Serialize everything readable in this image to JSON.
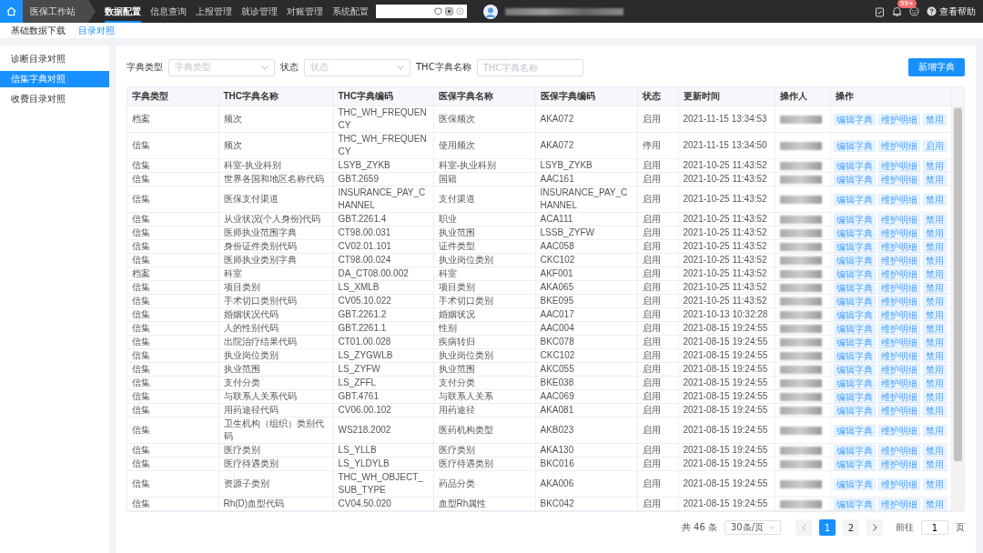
{
  "top_nav": {
    "workstation": "医保工作站",
    "menu": [
      {
        "label": "数据配置",
        "selected": true
      },
      {
        "label": "信息查询",
        "selected": false
      },
      {
        "label": "上报管理",
        "selected": false
      },
      {
        "label": "就诊管理",
        "selected": false
      },
      {
        "label": "对账管理",
        "selected": false
      },
      {
        "label": "系统配置",
        "selected": false
      }
    ],
    "badge": "99+",
    "help": "查看帮助"
  },
  "sub_nav": [
    {
      "label": "基础数据下载",
      "selected": false
    },
    {
      "label": "目录对照",
      "selected": true
    }
  ],
  "sidebar": [
    {
      "label": "诊断目录对照",
      "selected": false
    },
    {
      "label": "信集字典对照",
      "selected": true
    },
    {
      "label": "收费目录对照",
      "selected": false
    }
  ],
  "filters": [
    {
      "kind": "select",
      "label": "字典类型",
      "placeholder": "字典类型"
    },
    {
      "kind": "select",
      "label": "状态",
      "placeholder": "状态"
    },
    {
      "kind": "text",
      "label": "THC字典名称",
      "placeholder": "THC字典名称"
    }
  ],
  "add_button": "新增字典",
  "table": {
    "columns": [
      "字典类型",
      "THC字典名称",
      "THC字典编码",
      "医保字典名称",
      "医保字典编码",
      "状态",
      "更新时间",
      "操作人",
      "操作"
    ],
    "rows": [
      {
        "cells": [
          "档案",
          "频次",
          "THC_WH_FREQUENCY",
          "医保频次",
          "AKA072",
          "启用",
          "2021-11-15 13:34:53"
        ],
        "actions": [
          "编辑字典",
          "维护明细",
          "禁用"
        ]
      },
      {
        "cells": [
          "信集",
          "频次",
          "THC_WH_FREQUENCY",
          "使用频次",
          "AKA072",
          "停用",
          "2021-11-15 13:34:50"
        ],
        "actions": [
          "编辑字典",
          "维护明细",
          "启用"
        ]
      },
      {
        "cells": [
          "信集",
          "科室-执业科别",
          "LSYB_ZYKB",
          "科室-执业科别",
          "LSYB_ZYKB",
          "启用",
          "2021-10-25 11:43:52"
        ],
        "actions": [
          "编辑字典",
          "维护明细",
          "禁用"
        ]
      },
      {
        "cells": [
          "信集",
          "世界各国和地区名称代码",
          "GBT.2659",
          "国籍",
          "AAC161",
          "启用",
          "2021-10-25 11:43:52"
        ],
        "actions": [
          "编辑字典",
          "维护明细",
          "禁用"
        ]
      },
      {
        "cells": [
          "信集",
          "医保支付渠道",
          "INSURANCE_PAY_CHANNEL",
          "支付渠道",
          "INSURANCE_PAY_CHANNEL",
          "启用",
          "2021-10-25 11:43:52"
        ],
        "actions": [
          "编辑字典",
          "维护明细",
          "禁用"
        ]
      },
      {
        "cells": [
          "信集",
          "从业状况(个人身份)代码",
          "GBT.2261.4",
          "职业",
          "ACA111",
          "启用",
          "2021-10-25 11:43:52"
        ],
        "actions": [
          "编辑字典",
          "维护明细",
          "禁用"
        ]
      },
      {
        "cells": [
          "信集",
          "医师执业范围字典",
          "CT98.00.031",
          "执业范围",
          "LSSB_ZYFW",
          "启用",
          "2021-10-25 11:43:52"
        ],
        "actions": [
          "编辑字典",
          "维护明细",
          "禁用"
        ]
      },
      {
        "cells": [
          "信集",
          "身份证件类别代码",
          "CV02.01.101",
          "证件类型",
          "AAC058",
          "启用",
          "2021-10-25 11:43:52"
        ],
        "actions": [
          "编辑字典",
          "维护明细",
          "禁用"
        ]
      },
      {
        "cells": [
          "信集",
          "医师执业类别字典",
          "CT98.00.024",
          "执业岗位类别",
          "CKC102",
          "启用",
          "2021-10-25 11:43:52"
        ],
        "actions": [
          "编辑字典",
          "维护明细",
          "禁用"
        ]
      },
      {
        "cells": [
          "档案",
          "科室",
          "DA_CT08.00.002",
          "科室",
          "AKF001",
          "启用",
          "2021-10-25 11:43:52"
        ],
        "actions": [
          "编辑字典",
          "维护明细",
          "禁用"
        ]
      },
      {
        "cells": [
          "信集",
          "项目类别",
          "LS_XMLB",
          "项目类别",
          "AKA065",
          "启用",
          "2021-10-25 11:43:52"
        ],
        "actions": [
          "编辑字典",
          "维护明细",
          "禁用"
        ]
      },
      {
        "cells": [
          "信集",
          "手术切口类别代码",
          "CV05.10.022",
          "手术切口类别",
          "BKE095",
          "启用",
          "2021-10-25 11:43:52"
        ],
        "actions": [
          "编辑字典",
          "维护明细",
          "禁用"
        ]
      },
      {
        "cells": [
          "信集",
          "婚姻状况代码",
          "GBT.2261.2",
          "婚姻状况",
          "AAC017",
          "启用",
          "2021-10-13 10:32:28"
        ],
        "actions": [
          "编辑字典",
          "维护明细",
          "禁用"
        ]
      },
      {
        "cells": [
          "信集",
          "人的性别代码",
          "GBT.2261.1",
          "性别",
          "AAC004",
          "启用",
          "2021-08-15 19:24:55"
        ],
        "actions": [
          "编辑字典",
          "维护明细",
          "禁用"
        ]
      },
      {
        "cells": [
          "信集",
          "出院治疗结果代码",
          "CT01.00.028",
          "疾病转归",
          "BKC078",
          "启用",
          "2021-08-15 19:24:55"
        ],
        "actions": [
          "编辑字典",
          "维护明细",
          "禁用"
        ]
      },
      {
        "cells": [
          "信集",
          "执业岗位类别",
          "LS_ZYGWLB",
          "执业岗位类别",
          "CKC102",
          "启用",
          "2021-08-15 19:24:55"
        ],
        "actions": [
          "编辑字典",
          "维护明细",
          "禁用"
        ]
      },
      {
        "cells": [
          "信集",
          "执业范围",
          "LS_ZYFW",
          "执业范围",
          "AKC055",
          "启用",
          "2021-08-15 19:24:55"
        ],
        "actions": [
          "编辑字典",
          "维护明细",
          "禁用"
        ]
      },
      {
        "cells": [
          "信集",
          "支付分类",
          "LS_ZFFL",
          "支付分类",
          "BKE038",
          "启用",
          "2021-08-15 19:24:55"
        ],
        "actions": [
          "编辑字典",
          "维护明细",
          "禁用"
        ]
      },
      {
        "cells": [
          "信集",
          "与联系人关系代码",
          "GBT.4761",
          "与联系人关系",
          "AAC069",
          "启用",
          "2021-08-15 19:24:55"
        ],
        "actions": [
          "编辑字典",
          "维护明细",
          "禁用"
        ]
      },
      {
        "cells": [
          "信集",
          "用药途径代码",
          "CV06.00.102",
          "用药途径",
          "AKA081",
          "启用",
          "2021-08-15 19:24:55"
        ],
        "actions": [
          "编辑字典",
          "维护明细",
          "禁用"
        ]
      },
      {
        "cells": [
          "信集",
          "卫生机构（组织）类别代码",
          "WS218.2002",
          "医药机构类型",
          "AKB023",
          "启用",
          "2021-08-15 19:24:55"
        ],
        "actions": [
          "编辑字典",
          "维护明细",
          "禁用"
        ]
      },
      {
        "cells": [
          "信集",
          "医疗类别",
          "LS_YLLB",
          "医疗类别",
          "AKA130",
          "启用",
          "2021-08-15 19:24:55"
        ],
        "actions": [
          "编辑字典",
          "维护明细",
          "禁用"
        ]
      },
      {
        "cells": [
          "信集",
          "医疗待遇类别",
          "LS_YLDYLB",
          "医疗待遇类别",
          "BKC016",
          "启用",
          "2021-08-15 19:24:55"
        ],
        "actions": [
          "编辑字典",
          "维护明细",
          "禁用"
        ]
      },
      {
        "cells": [
          "信集",
          "资源子类别",
          "THC_WH_OBJECT_SUB_TYPE",
          "药品分类",
          "AKA006",
          "启用",
          "2021-08-15 19:24:55"
        ],
        "actions": [
          "编辑字典",
          "维护明细",
          "禁用"
        ]
      },
      {
        "cells": [
          "信集",
          "Rh(D)血型代码",
          "CV04.50.020",
          "血型Rh属性",
          "BKC042",
          "启用",
          "2021-08-15 19:24:55"
        ],
        "actions": [
          "编辑字典",
          "维护明细",
          "禁用"
        ]
      }
    ]
  },
  "pagination": {
    "total": "共 46 条",
    "page_size": "30条/页",
    "pages": [
      {
        "label": "1",
        "selected": true
      },
      {
        "label": "2",
        "selected": false
      }
    ],
    "goto_label": "前往",
    "goto_value": "1",
    "page_suffix": "页"
  }
}
